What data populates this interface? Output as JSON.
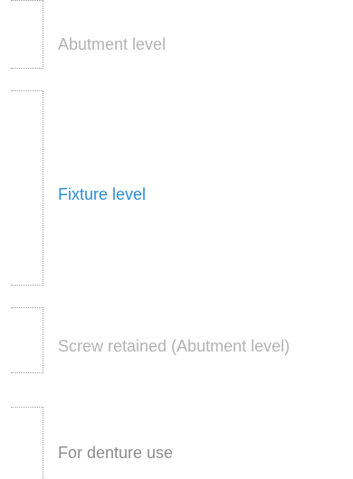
{
  "options": [
    {
      "label": "Abutment level",
      "state": "default"
    },
    {
      "label": "Fixture level",
      "state": "selected"
    },
    {
      "label": "Screw retained (Abutment level)",
      "state": "default"
    },
    {
      "label": "For denture use",
      "state": "default"
    }
  ],
  "colors": {
    "selected": "#2a8fd6",
    "default": "#b3b3b3",
    "bracket": "#9a9a9a"
  }
}
